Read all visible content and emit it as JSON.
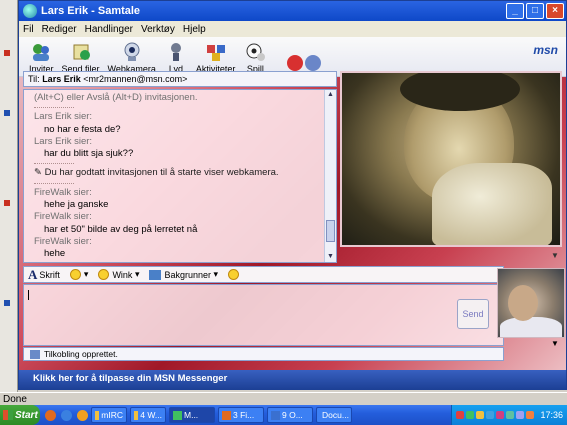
{
  "window": {
    "title": "Lars Erik - Samtale"
  },
  "menu": [
    "Fil",
    "Rediger",
    "Handlinger",
    "Verktøy",
    "Hjelp"
  ],
  "toolbar": {
    "items": [
      {
        "label": "Inviter",
        "icon": "invite-icon"
      },
      {
        "label": "Send filer",
        "icon": "send-files-icon"
      },
      {
        "label": "Webkamera",
        "icon": "webcam-icon"
      },
      {
        "label": "Lyd",
        "icon": "audio-icon"
      },
      {
        "label": "Aktiviteter",
        "icon": "activities-icon"
      },
      {
        "label": "Spill",
        "icon": "games-icon"
      }
    ],
    "brand": "msn"
  },
  "conversation": {
    "to_label": "Til:",
    "to_name": "Lars Erik",
    "to_email": "<mr2mannen@msn.com>",
    "messages": [
      {
        "type": "cut",
        "text": "(Alt+C) eller Avslå (Alt+D) invitasjonen."
      },
      {
        "type": "who",
        "text": "Lars Erik sier:"
      },
      {
        "type": "msg",
        "text": "no har e festa de?"
      },
      {
        "type": "who",
        "text": "Lars Erik sier:"
      },
      {
        "type": "msg",
        "text": "har du blitt sja sjuk??"
      },
      {
        "type": "sys",
        "text": "Du har godtatt invitasjonen til å starte viser webkamera."
      },
      {
        "type": "who",
        "text": "FireWalk sier:"
      },
      {
        "type": "msg",
        "text": "hehe ja ganske"
      },
      {
        "type": "who",
        "text": "FireWalk sier:"
      },
      {
        "type": "msg",
        "text": "har et 50\" bilde av deg på lerretet nå"
      },
      {
        "type": "who",
        "text": "FireWalk sier:"
      },
      {
        "type": "msg",
        "text": "hehe"
      }
    ]
  },
  "format_bar": {
    "font": "Skrift",
    "wink": "Wink",
    "background": "Bakgrunner"
  },
  "input": {
    "value": "",
    "send": "Send"
  },
  "status_line": "Tilkobling opprettet.",
  "ad_bar": "Klikk her for å tilpasse din MSN Messenger",
  "browser_status": "Done",
  "taskbar": {
    "start": "Start",
    "tasks": [
      "mIRC",
      "4 W...",
      "M...",
      "3 Fi...",
      "9 O...",
      "Docu..."
    ],
    "clock": "17:36"
  }
}
